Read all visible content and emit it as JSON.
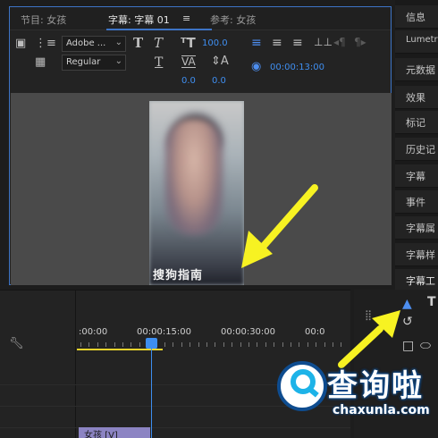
{
  "title_panel": {
    "tabs": [
      {
        "label": "节目: 女孩"
      },
      {
        "label": "字幕: 字幕 01"
      },
      {
        "label": "参考: 女孩"
      }
    ],
    "menu_icon": "hamburger-icon",
    "toolbar": {
      "font_family": "Adobe ...",
      "font_style": "Regular",
      "font_size": "100.0",
      "tracking": "0.0",
      "leading": "0.0",
      "timecode": "00:00:13:00"
    },
    "caption_text": "搜狗指南"
  },
  "right_panels": [
    "信息",
    "Lumetri",
    "元数据",
    "效果",
    "标记",
    "历史记",
    "字幕",
    "事件",
    "字幕属",
    "字幕样",
    "字幕工"
  ],
  "timeline": {
    "time_labels": [
      ":00:00",
      "00:00:15:00",
      "00:00:30:00",
      "00:0"
    ],
    "clip_label": "女孩 [V]"
  },
  "watermark": {
    "text": "查询啦",
    "url": "chaxunla.com"
  },
  "colors": {
    "accent": "#3d74c6",
    "playhead": "#3d8ef0",
    "work_area": "#e8d32c",
    "clip": "#8c84c3",
    "arrow": "#f7f222"
  }
}
